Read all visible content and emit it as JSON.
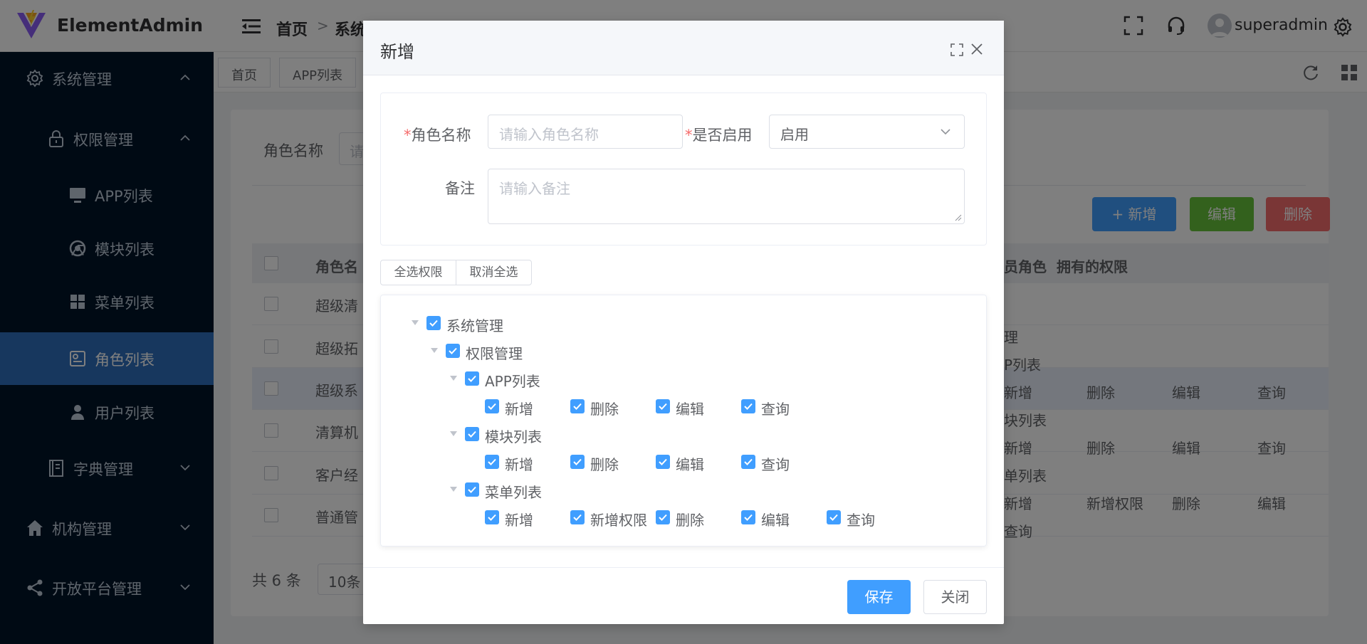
{
  "header": {
    "brand": "ElementAdmin",
    "breadcrumb": [
      "首页",
      "系统"
    ],
    "username": "superadmin"
  },
  "sidebar": {
    "items": [
      {
        "label": "系统管理",
        "icon": "gear-icon",
        "expanded": true
      },
      {
        "label": "权限管理",
        "icon": "lock-icon",
        "expanded": true
      },
      {
        "label": "APP列表",
        "icon": "monitor-icon"
      },
      {
        "label": "模块列表",
        "icon": "chrome-icon"
      },
      {
        "label": "菜单列表",
        "icon": "grid-icon"
      },
      {
        "label": "角色列表",
        "icon": "role-icon",
        "active": true
      },
      {
        "label": "用户列表",
        "icon": "user-icon"
      },
      {
        "label": "字典管理",
        "icon": "book-icon",
        "expanded": false
      },
      {
        "label": "机构管理",
        "icon": "home-icon",
        "expanded": false
      },
      {
        "label": "开放平台管理",
        "icon": "share-icon",
        "expanded": false
      }
    ]
  },
  "tabs": [
    "首页",
    "APP列表"
  ],
  "content": {
    "search_label": "角色名称",
    "search_placeholder": "请",
    "buttons": {
      "add": "+ 新增",
      "edit": "编辑",
      "delete": "删除"
    },
    "table": {
      "headers": [
        "角色名",
        "员角色",
        "拥有的权限"
      ],
      "rows": [
        "超级清",
        "超级拓",
        "超级系",
        "清算机",
        "客户经",
        "普通管"
      ],
      "visible_perms": [
        "理",
        "P列表",
        "新增",
        "删除",
        "编辑",
        "查询",
        "块列表",
        "新增",
        "删除",
        "编辑",
        "查询",
        "单列表",
        "新增",
        "新增权限",
        "删除",
        "编辑",
        "查询"
      ]
    },
    "total": "共 6 条",
    "page_size": "10条"
  },
  "dialog": {
    "title": "新增",
    "role_name_label": "角色名称",
    "role_name_placeholder": "请输入角色名称",
    "enabled_label": "是否启用",
    "enabled_value": "启用",
    "remark_label": "备注",
    "remark_placeholder": "请输入备注",
    "select_all": "全选权限",
    "deselect_all": "取消全选",
    "tree": {
      "root": "系统管理",
      "child": "权限管理",
      "groups": [
        {
          "label": "APP列表",
          "actions": [
            "新增",
            "删除",
            "编辑",
            "查询"
          ]
        },
        {
          "label": "模块列表",
          "actions": [
            "新增",
            "删除",
            "编辑",
            "查询"
          ]
        },
        {
          "label": "菜单列表",
          "actions": [
            "新增",
            "新增权限",
            "删除",
            "编辑",
            "查询"
          ]
        }
      ]
    },
    "save": "保存",
    "close": "关闭"
  },
  "colors": {
    "primary": "#409eff",
    "success": "#67c23a",
    "danger": "#f56c6c",
    "sidebar_bg": "#001529",
    "sidebar_active": "#2e6fbd"
  }
}
